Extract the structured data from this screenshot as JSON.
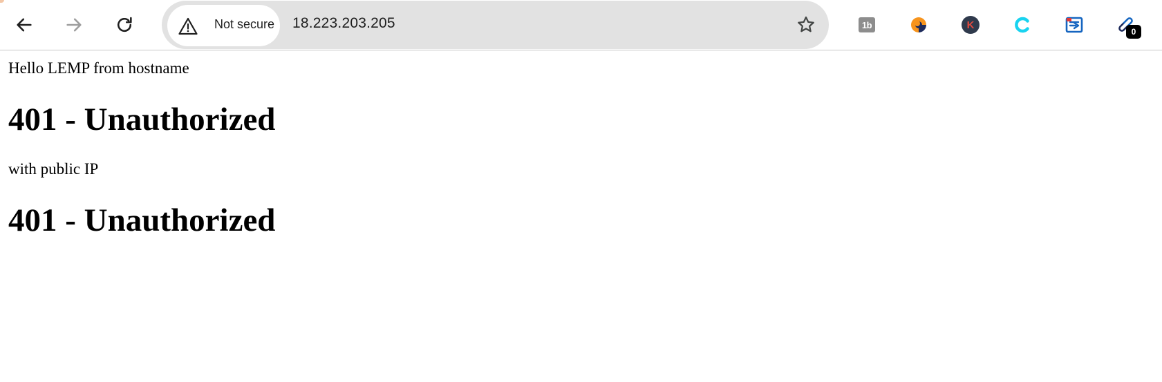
{
  "browser": {
    "security_chip": {
      "label": "Not secure",
      "icon": "warning-triangle-icon"
    },
    "url": "18.223.203.205",
    "nav": {
      "back_icon": "arrow-left-icon",
      "forward_icon": "arrow-right-icon",
      "reload_icon": "reload-icon"
    },
    "bookmark_icon": "star-outline-icon",
    "extensions": [
      {
        "name": "1b-extension-icon",
        "glyph": "1b"
      },
      {
        "name": "orange-navy-swirl-extension-icon"
      },
      {
        "name": "k-extension-icon",
        "glyph": "K"
      },
      {
        "name": "cyan-c-extension-icon"
      },
      {
        "name": "blue-frame-extension-icon"
      },
      {
        "name": "link-extension-icon",
        "badge": "0"
      }
    ]
  },
  "page": {
    "line1": "Hello LEMP from hostname",
    "heading1": "401 - Unauthorized",
    "line2": "with public IP",
    "heading2": "401 - Unauthorized"
  },
  "colors": {
    "toolbar_bg": "#ffffff",
    "omnibox_bg": "#e2e2e2",
    "chip_bg": "#ffffff",
    "text": "#1f1f1f",
    "disabled_icon": "#9e9e9e",
    "cyan_accent": "#19d3f0",
    "orange_accent": "#f7941d",
    "navy_accent": "#1e2b5c"
  }
}
